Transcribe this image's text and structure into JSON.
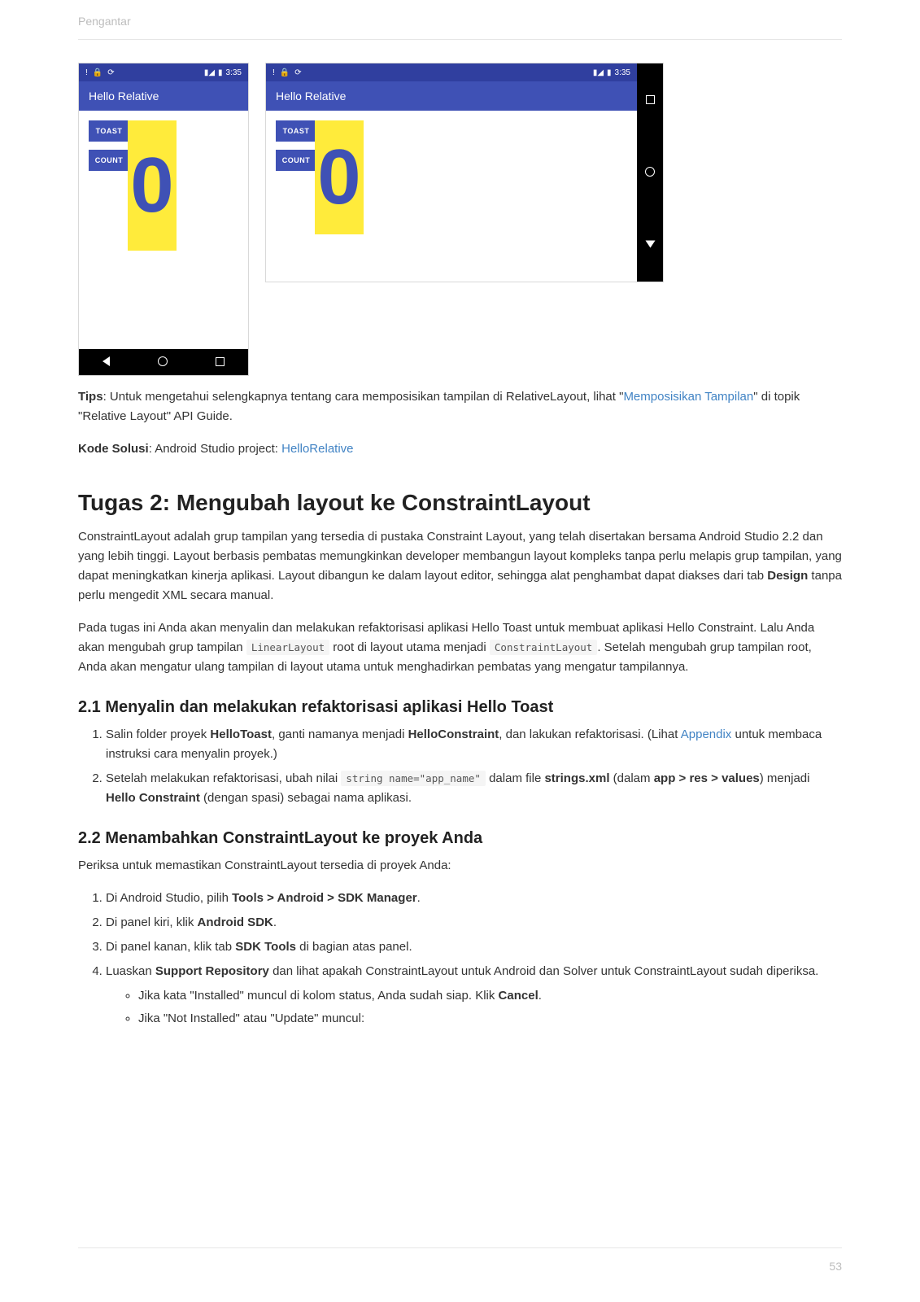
{
  "header": {
    "title": "Pengantar"
  },
  "phone": {
    "status_time": "3:35",
    "app_title": "Hello Relative",
    "btn_toast": "TOAST",
    "btn_count": "COUNT",
    "counter_value": "0"
  },
  "tips": {
    "label": "Tips",
    "text1": ": Untuk mengetahui selengkapnya tentang cara memposisikan tampilan di RelativeLayout, lihat \"",
    "link1": "Memposisikan Tampilan",
    "text2": "\" di topik \"Relative Layout\" API Guide."
  },
  "solution": {
    "label": "Kode Solusi",
    "text": ": Android Studio project: ",
    "link": "HelloRelative"
  },
  "task2": {
    "heading": "Tugas 2: Mengubah layout ke ConstraintLayout",
    "para1": "ConstraintLayout adalah grup tampilan yang tersedia di pustaka Constraint Layout, yang telah disertakan bersama Android Studio 2.2 dan yang lebih tinggi. Layout berbasis pembatas memungkinkan developer membangun layout kompleks tanpa perlu melapis grup tampilan, yang dapat meningkatkan kinerja aplikasi. Layout dibangun ke dalam layout editor, sehingga alat penghambat dapat diakses dari tab ",
    "para1_bold": "Design",
    "para1_after": " tanpa perlu mengedit XML secara manual.",
    "para2a": "Pada tugas ini Anda akan menyalin dan melakukan refaktorisasi aplikasi Hello Toast untuk membuat aplikasi Hello Constraint. Lalu Anda akan mengubah grup tampilan ",
    "code1": "LinearLayout",
    "para2b": " root di layout utama menjadi ",
    "code2": "ConstraintLayout",
    "para2c": ". Setelah mengubah grup tampilan root, Anda akan mengatur ulang tampilan di layout utama untuk menghadirkan pembatas yang mengatur tampilannya."
  },
  "s21": {
    "heading": "2.1 Menyalin dan melakukan refaktorisasi aplikasi Hello Toast",
    "li1a": "Salin folder proyek ",
    "li1_bold1": "HelloToast",
    "li1b": ", ganti namanya menjadi ",
    "li1_bold2": "HelloConstraint",
    "li1c": ", dan lakukan refaktorisasi. (Lihat ",
    "li1_link": "Appendix",
    "li1d": " untuk membaca instruksi cara menyalin proyek.)",
    "li2a": "Setelah melakukan refaktorisasi, ubah nilai ",
    "li2_code": "string name=\"app_name\"",
    "li2b": " dalam file ",
    "li2_bold1": "strings.xml",
    "li2c": " (dalam ",
    "li2_bold2": "app > res > values",
    "li2d": ") menjadi ",
    "li2_bold3": "Hello Constraint",
    "li2e": " (dengan spasi) sebagai nama aplikasi."
  },
  "s22": {
    "heading": "2.2 Menambahkan ConstraintLayout ke proyek Anda",
    "intro": "Periksa untuk memastikan ConstraintLayout tersedia di proyek Anda:",
    "li1a": "Di Android Studio, pilih ",
    "li1_bold": "Tools > Android > SDK Manager",
    "li1b": ".",
    "li2a": "Di panel kiri, klik ",
    "li2_bold": "Android SDK",
    "li2b": ".",
    "li3a": "Di panel kanan, klik tab ",
    "li3_bold": "SDK Tools",
    "li3b": " di bagian atas panel.",
    "li4a": "Luaskan ",
    "li4_bold": "Support Repository",
    "li4b": " dan lihat apakah ConstraintLayout untuk Android dan Solver untuk ConstraintLayout sudah diperiksa.",
    "sub1a": "Jika kata \"Installed\" muncul di kolom status, Anda sudah siap. Klik ",
    "sub1_bold": "Cancel",
    "sub1b": ".",
    "sub2": "Jika \"Not Installed\" atau \"Update\" muncul:"
  },
  "page_number": "53"
}
